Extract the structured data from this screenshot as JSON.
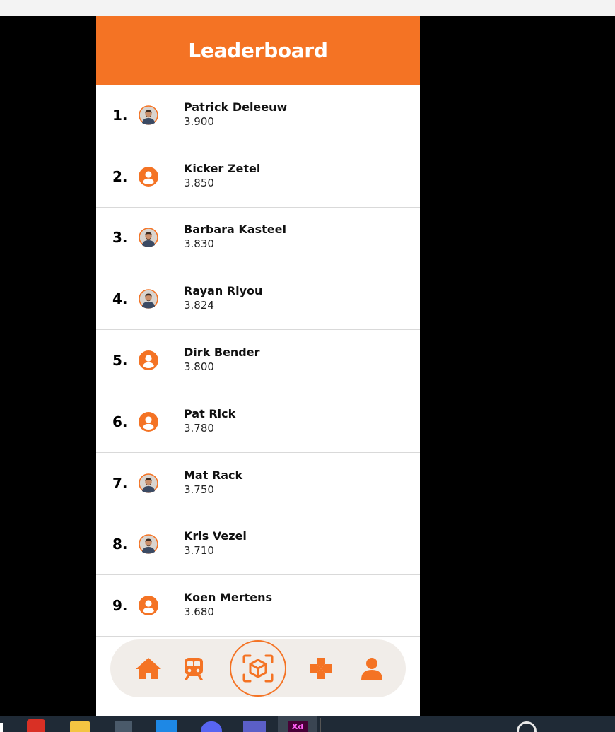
{
  "header": {
    "title": "Leaderboard"
  },
  "colors": {
    "accent": "#f47324",
    "nav_bg": "#f1ede9",
    "divider": "#d9d9d9"
  },
  "leaderboard": [
    {
      "rank": "1.",
      "name": "Patrick Deleeuw",
      "score": "3.900",
      "avatar": "photo"
    },
    {
      "rank": "2.",
      "name": "Kicker Zetel",
      "score": "3.850",
      "avatar": "person-icon"
    },
    {
      "rank": "3.",
      "name": "Barbara Kasteel",
      "score": "3.830",
      "avatar": "photo"
    },
    {
      "rank": "4.",
      "name": "Rayan Riyou",
      "score": "3.824",
      "avatar": "photo"
    },
    {
      "rank": "5.",
      "name": "Dirk Bender",
      "score": "3.800",
      "avatar": "person-icon"
    },
    {
      "rank": "6.",
      "name": "Pat Rick",
      "score": "3.780",
      "avatar": "person-icon"
    },
    {
      "rank": "7.",
      "name": "Mat Rack",
      "score": "3.750",
      "avatar": "photo"
    },
    {
      "rank": "8.",
      "name": "Kris Vezel",
      "score": "3.710",
      "avatar": "photo"
    },
    {
      "rank": "9.",
      "name": "Koen Mertens",
      "score": "3.680",
      "avatar": "person-icon"
    }
  ],
  "bottom_nav": [
    {
      "icon": "home-icon"
    },
    {
      "icon": "train-icon"
    },
    {
      "icon": "ar-scan-icon"
    },
    {
      "icon": "gamepad-icon"
    },
    {
      "icon": "profile-icon"
    }
  ],
  "taskbar": {
    "apps": [
      "app-icon",
      "file-explorer-icon",
      "app-icon",
      "vscode-icon",
      "discord-icon",
      "teams-icon",
      "adobe-xd-icon",
      "app-icon"
    ],
    "xd_label": "Xd"
  }
}
